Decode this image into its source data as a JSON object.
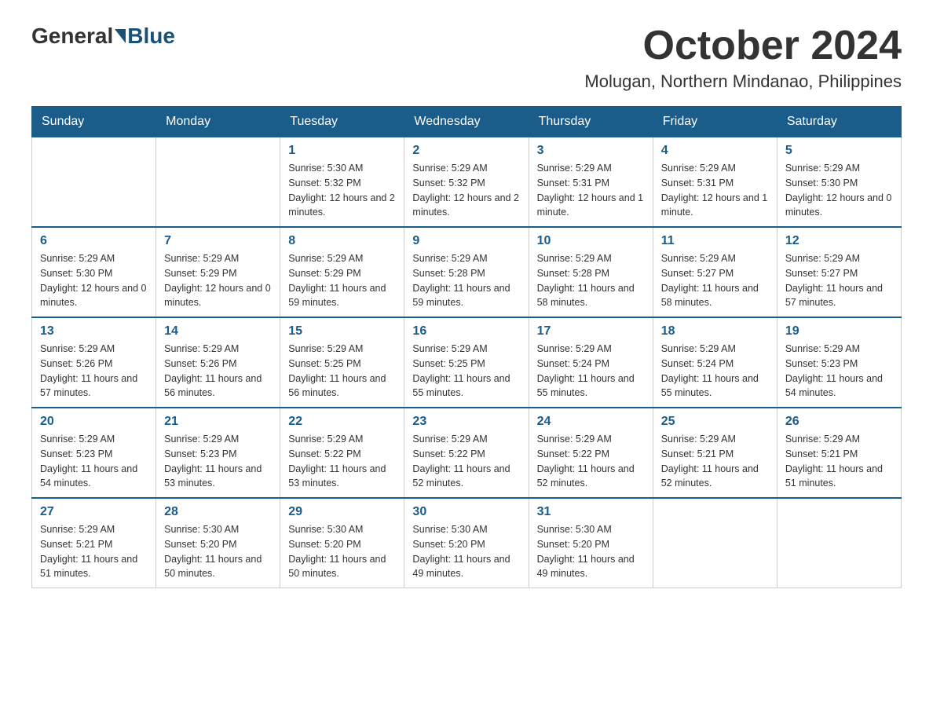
{
  "header": {
    "logo_general": "General",
    "logo_blue": "Blue",
    "month_title": "October 2024",
    "location": "Molugan, Northern Mindanao, Philippines"
  },
  "weekdays": [
    "Sunday",
    "Monday",
    "Tuesday",
    "Wednesday",
    "Thursday",
    "Friday",
    "Saturday"
  ],
  "weeks": [
    [
      {
        "day": "",
        "sunrise": "",
        "sunset": "",
        "daylight": ""
      },
      {
        "day": "",
        "sunrise": "",
        "sunset": "",
        "daylight": ""
      },
      {
        "day": "1",
        "sunrise": "Sunrise: 5:30 AM",
        "sunset": "Sunset: 5:32 PM",
        "daylight": "Daylight: 12 hours and 2 minutes."
      },
      {
        "day": "2",
        "sunrise": "Sunrise: 5:29 AM",
        "sunset": "Sunset: 5:32 PM",
        "daylight": "Daylight: 12 hours and 2 minutes."
      },
      {
        "day": "3",
        "sunrise": "Sunrise: 5:29 AM",
        "sunset": "Sunset: 5:31 PM",
        "daylight": "Daylight: 12 hours and 1 minute."
      },
      {
        "day": "4",
        "sunrise": "Sunrise: 5:29 AM",
        "sunset": "Sunset: 5:31 PM",
        "daylight": "Daylight: 12 hours and 1 minute."
      },
      {
        "day": "5",
        "sunrise": "Sunrise: 5:29 AM",
        "sunset": "Sunset: 5:30 PM",
        "daylight": "Daylight: 12 hours and 0 minutes."
      }
    ],
    [
      {
        "day": "6",
        "sunrise": "Sunrise: 5:29 AM",
        "sunset": "Sunset: 5:30 PM",
        "daylight": "Daylight: 12 hours and 0 minutes."
      },
      {
        "day": "7",
        "sunrise": "Sunrise: 5:29 AM",
        "sunset": "Sunset: 5:29 PM",
        "daylight": "Daylight: 12 hours and 0 minutes."
      },
      {
        "day": "8",
        "sunrise": "Sunrise: 5:29 AM",
        "sunset": "Sunset: 5:29 PM",
        "daylight": "Daylight: 11 hours and 59 minutes."
      },
      {
        "day": "9",
        "sunrise": "Sunrise: 5:29 AM",
        "sunset": "Sunset: 5:28 PM",
        "daylight": "Daylight: 11 hours and 59 minutes."
      },
      {
        "day": "10",
        "sunrise": "Sunrise: 5:29 AM",
        "sunset": "Sunset: 5:28 PM",
        "daylight": "Daylight: 11 hours and 58 minutes."
      },
      {
        "day": "11",
        "sunrise": "Sunrise: 5:29 AM",
        "sunset": "Sunset: 5:27 PM",
        "daylight": "Daylight: 11 hours and 58 minutes."
      },
      {
        "day": "12",
        "sunrise": "Sunrise: 5:29 AM",
        "sunset": "Sunset: 5:27 PM",
        "daylight": "Daylight: 11 hours and 57 minutes."
      }
    ],
    [
      {
        "day": "13",
        "sunrise": "Sunrise: 5:29 AM",
        "sunset": "Sunset: 5:26 PM",
        "daylight": "Daylight: 11 hours and 57 minutes."
      },
      {
        "day": "14",
        "sunrise": "Sunrise: 5:29 AM",
        "sunset": "Sunset: 5:26 PM",
        "daylight": "Daylight: 11 hours and 56 minutes."
      },
      {
        "day": "15",
        "sunrise": "Sunrise: 5:29 AM",
        "sunset": "Sunset: 5:25 PM",
        "daylight": "Daylight: 11 hours and 56 minutes."
      },
      {
        "day": "16",
        "sunrise": "Sunrise: 5:29 AM",
        "sunset": "Sunset: 5:25 PM",
        "daylight": "Daylight: 11 hours and 55 minutes."
      },
      {
        "day": "17",
        "sunrise": "Sunrise: 5:29 AM",
        "sunset": "Sunset: 5:24 PM",
        "daylight": "Daylight: 11 hours and 55 minutes."
      },
      {
        "day": "18",
        "sunrise": "Sunrise: 5:29 AM",
        "sunset": "Sunset: 5:24 PM",
        "daylight": "Daylight: 11 hours and 55 minutes."
      },
      {
        "day": "19",
        "sunrise": "Sunrise: 5:29 AM",
        "sunset": "Sunset: 5:23 PM",
        "daylight": "Daylight: 11 hours and 54 minutes."
      }
    ],
    [
      {
        "day": "20",
        "sunrise": "Sunrise: 5:29 AM",
        "sunset": "Sunset: 5:23 PM",
        "daylight": "Daylight: 11 hours and 54 minutes."
      },
      {
        "day": "21",
        "sunrise": "Sunrise: 5:29 AM",
        "sunset": "Sunset: 5:23 PM",
        "daylight": "Daylight: 11 hours and 53 minutes."
      },
      {
        "day": "22",
        "sunrise": "Sunrise: 5:29 AM",
        "sunset": "Sunset: 5:22 PM",
        "daylight": "Daylight: 11 hours and 53 minutes."
      },
      {
        "day": "23",
        "sunrise": "Sunrise: 5:29 AM",
        "sunset": "Sunset: 5:22 PM",
        "daylight": "Daylight: 11 hours and 52 minutes."
      },
      {
        "day": "24",
        "sunrise": "Sunrise: 5:29 AM",
        "sunset": "Sunset: 5:22 PM",
        "daylight": "Daylight: 11 hours and 52 minutes."
      },
      {
        "day": "25",
        "sunrise": "Sunrise: 5:29 AM",
        "sunset": "Sunset: 5:21 PM",
        "daylight": "Daylight: 11 hours and 52 minutes."
      },
      {
        "day": "26",
        "sunrise": "Sunrise: 5:29 AM",
        "sunset": "Sunset: 5:21 PM",
        "daylight": "Daylight: 11 hours and 51 minutes."
      }
    ],
    [
      {
        "day": "27",
        "sunrise": "Sunrise: 5:29 AM",
        "sunset": "Sunset: 5:21 PM",
        "daylight": "Daylight: 11 hours and 51 minutes."
      },
      {
        "day": "28",
        "sunrise": "Sunrise: 5:30 AM",
        "sunset": "Sunset: 5:20 PM",
        "daylight": "Daylight: 11 hours and 50 minutes."
      },
      {
        "day": "29",
        "sunrise": "Sunrise: 5:30 AM",
        "sunset": "Sunset: 5:20 PM",
        "daylight": "Daylight: 11 hours and 50 minutes."
      },
      {
        "day": "30",
        "sunrise": "Sunrise: 5:30 AM",
        "sunset": "Sunset: 5:20 PM",
        "daylight": "Daylight: 11 hours and 49 minutes."
      },
      {
        "day": "31",
        "sunrise": "Sunrise: 5:30 AM",
        "sunset": "Sunset: 5:20 PM",
        "daylight": "Daylight: 11 hours and 49 minutes."
      },
      {
        "day": "",
        "sunrise": "",
        "sunset": "",
        "daylight": ""
      },
      {
        "day": "",
        "sunrise": "",
        "sunset": "",
        "daylight": ""
      }
    ]
  ]
}
